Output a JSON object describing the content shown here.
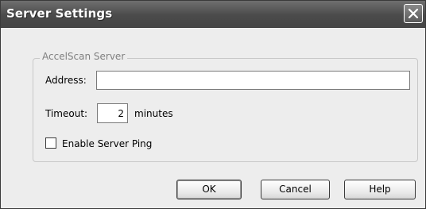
{
  "window": {
    "title": "Server Settings",
    "close_icon": "close-icon"
  },
  "group": {
    "label": "AccelScan Server"
  },
  "address": {
    "label": "Address:",
    "value": ""
  },
  "timeout": {
    "label": "Timeout:",
    "value": "2",
    "unit": "minutes"
  },
  "ping": {
    "label": "Enable Server Ping",
    "checked": false
  },
  "buttons": {
    "ok": "OK",
    "cancel": "Cancel",
    "help": "Help"
  }
}
